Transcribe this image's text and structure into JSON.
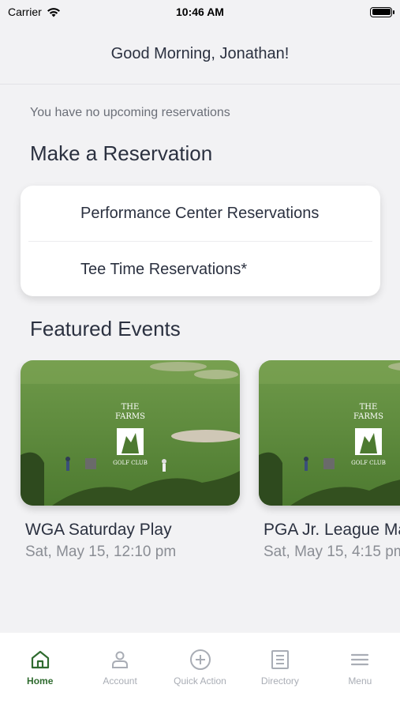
{
  "status_bar": {
    "carrier": "Carrier",
    "time": "10:46 AM"
  },
  "header": {
    "greeting": "Good Morning, Jonathan!"
  },
  "reservations": {
    "empty_message": "You have no upcoming reservations",
    "section_title": "Make a Reservation",
    "items": [
      {
        "label": "Performance Center Reservations"
      },
      {
        "label": "Tee Time Reservations*"
      }
    ]
  },
  "featured": {
    "section_title": "Featured Events",
    "events": [
      {
        "title": "WGA Saturday Play",
        "date": "Sat, May 15, 12:10 pm",
        "logo_top": "THE",
        "logo_mid": "FARMS",
        "logo_bottom": "GOLF CLUB"
      },
      {
        "title": "PGA Jr. League Match Home",
        "date": "Sat, May 15, 4:15 pm",
        "logo_top": "THE",
        "logo_mid": "FARMS",
        "logo_bottom": "GOLF CLUB"
      }
    ]
  },
  "tabbar": {
    "tabs": [
      {
        "label": "Home",
        "icon": "home-icon",
        "active": true
      },
      {
        "label": "Account",
        "icon": "person-icon"
      },
      {
        "label": "Quick Action",
        "icon": "plus-circle-icon"
      },
      {
        "label": "Directory",
        "icon": "directory-icon"
      },
      {
        "label": "Menu",
        "icon": "menu-icon"
      }
    ]
  },
  "colors": {
    "accent": "#2f6b2f",
    "background": "#f2f2f4",
    "text": "#2b3140",
    "muted": "#8a8d94"
  }
}
